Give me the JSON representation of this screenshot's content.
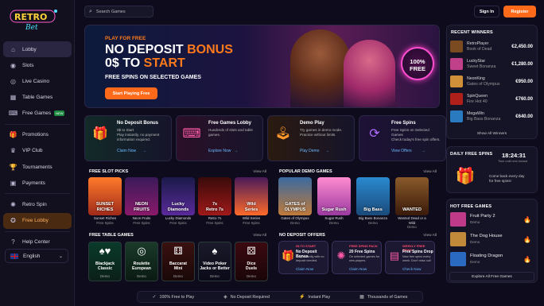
{
  "brand": {
    "logo_top": "RETRO",
    "logo_bottom": "Bet"
  },
  "sidebar": {
    "items": [
      {
        "label": "Lobby",
        "icon": "home-icon"
      },
      {
        "label": "Slots",
        "icon": "slots-icon"
      },
      {
        "label": "Live Casino",
        "icon": "live-icon"
      },
      {
        "label": "Table Games",
        "icon": "cards-icon"
      },
      {
        "label": "Free Games",
        "icon": "gamepad-icon",
        "badge": "NEW"
      },
      {
        "label": "Promotions",
        "icon": "gift-icon"
      },
      {
        "label": "VIP Club",
        "icon": "crown-icon"
      },
      {
        "label": "Tournaments",
        "icon": "trophy-icon"
      },
      {
        "label": "Payments",
        "icon": "wallet-icon"
      },
      {
        "label": "Retro Spin",
        "icon": "spin-icon"
      },
      {
        "label": "Free Lobby",
        "icon": "free-lobby-icon"
      },
      {
        "label": "Help Center",
        "icon": "help-icon"
      }
    ],
    "language": "English"
  },
  "header": {
    "search_placeholder": "Search Games",
    "signin": "Sign In",
    "register": "Register"
  },
  "hero": {
    "kicker": "PLAY FOR FREE",
    "line1a": "NO DEPOSIT ",
    "line1b": "BONUS",
    "line2a": "0$ TO ",
    "line2b": "START",
    "sub": "FREE SPINS ON SELECTED GAMES",
    "cta": "Start Playing Free",
    "seal_1": "100%",
    "seal_2": "FREE"
  },
  "winners": {
    "title": "RECENT WINNERS",
    "rows": [
      {
        "user": "RetroPlayer",
        "game": "Book of Dead",
        "amount": "€2,450.00",
        "color": "#7a4a20"
      },
      {
        "user": "LuckyStar",
        "game": "Sweet Bonanza",
        "amount": "€1,280.00",
        "color": "#c0408a"
      },
      {
        "user": "NeonKing",
        "game": "Gates of Olympus",
        "amount": "€950.00",
        "color": "#d0903a"
      },
      {
        "user": "SpinQueen",
        "game": "Fire Hot 40",
        "amount": "€760.00",
        "color": "#b0201a"
      },
      {
        "user": "MegaWin",
        "game": "Big Bass Bonanza",
        "amount": "€640.00",
        "color": "#2a7ac0"
      }
    ],
    "link": "Show All Winners"
  },
  "promo_cards": [
    {
      "title": "No Deposit Bonus",
      "desc": "0$ to Start\nPlay instantly, no payment information required.",
      "link": "Claim Now",
      "icon": "gift-icon",
      "icon_color": "#3fe0a0",
      "bg": "#122a28"
    },
    {
      "title": "Free Games Lobby",
      "desc": "Hundreds of slots and table games.",
      "link": "Explore Now",
      "icon": "gamepad-icon",
      "icon_color": "#ff5aa8",
      "bg": "#2a1028"
    },
    {
      "title": "Demo Play",
      "desc": "Try games in demo mode. Practice without limits.",
      "link": "Play Demo",
      "icon": "joystick-icon",
      "icon_color": "#ff9a2a",
      "bg": "#2a1a10"
    },
    {
      "title": "Free Spins",
      "desc": "Free Spins on Selected Games\nCheck today's free spin offers.",
      "link": "View Offers",
      "icon": "refresh-icon",
      "icon_color": "#b06aff",
      "bg": "#1e1236"
    }
  ],
  "daily": {
    "title": "DAILY FREE SPINS",
    "timer": "18:24:31",
    "timer_label": "Time until next reward",
    "msg": "Come back every day\nfor free spins!"
  },
  "free_slots": {
    "title": "FREE SLOT PICKS",
    "view_all": "View All",
    "games": [
      {
        "art": "SUNSET\nRICHES",
        "name": "Sunset Riches",
        "tag": "Free Spins",
        "bg": "linear-gradient(#ff7a2a,#a02a1a)"
      },
      {
        "art": "NEON\nFRUITS",
        "name": "Neon Fruits",
        "tag": "Free Spins",
        "bg": "linear-gradient(#3a1a5a,#8a1a6a)"
      },
      {
        "art": "Lucky\nDiamonds",
        "name": "Lucky Diamonds",
        "tag": "Free Spins",
        "bg": "linear-gradient(#1a1a4a,#5a2a9a)"
      },
      {
        "art": "7s\nRetro 7s",
        "name": "Retro 7s",
        "tag": "Free Spins",
        "bg": "linear-gradient(#3a0a0a,#a01a1a)"
      },
      {
        "art": "Wild\nSeries",
        "name": "Wild Series",
        "tag": "Free Spins",
        "bg": "linear-gradient(#4a1a5a,#ff6a2a)"
      }
    ]
  },
  "demo_games": {
    "title": "POPULAR DEMO GAMES",
    "view_all": "View All",
    "games": [
      {
        "art": "GATES of OLYMPUS",
        "name": "Gates of Olympus",
        "tag": "Demo",
        "bg": "linear-gradient(#3a6aa0,#c07a3a)"
      },
      {
        "art": "Sugar Rush",
        "name": "Sugar Rush",
        "tag": "Demo",
        "bg": "linear-gradient(#ff8ad0,#9a3aa0)"
      },
      {
        "art": "Big Bass",
        "name": "Big Bass Bonanza",
        "tag": "Demo",
        "bg": "linear-gradient(#2a8ad0,#1a4a7a)"
      },
      {
        "art": "WANTED",
        "name": "Wanted Dead or a Wild",
        "tag": "Demo",
        "bg": "linear-gradient(#8a5a2a,#3a1a0a)"
      }
    ]
  },
  "table_games": {
    "title": "FREE TABLE GAMES",
    "view_all": "View All",
    "games": [
      {
        "name": "Blackjack\nClassic",
        "tag": "Demo",
        "art": "♠♥",
        "bg": "linear-gradient(#0a3a2a,#0a2018)"
      },
      {
        "name": "Roulette\nEuropean",
        "tag": "Demo",
        "art": "◎",
        "bg": "linear-gradient(#1a3a2a,#0a1a12)"
      },
      {
        "name": "Baccarat\nMini",
        "tag": "Demo",
        "art": "⚅",
        "bg": "linear-gradient(#3a1010,#1a0808)"
      },
      {
        "name": "Video Poker\nJacks or Better",
        "tag": "Demo",
        "art": "♠",
        "bg": "linear-gradient(#1a1a2a,#0a0a18)"
      },
      {
        "name": "Dice\nDuels",
        "tag": "Demo",
        "art": "⚄",
        "bg": "linear-gradient(#3a0a10,#1a0508)"
      }
    ]
  },
  "offers": {
    "title": "NO DEPOSIT OFFERS",
    "view_all": "View All",
    "items": [
      {
        "tag": "0$ TO START",
        "name": "No Deposit Bonus",
        "desc": "Play instantly with no deposit needed.",
        "link": "Claim Now",
        "icon": "gift-icon",
        "icon_color": "#3fe0a0"
      },
      {
        "tag": "FREE SPINS PACK",
        "name": "20 Free Spins",
        "desc": "On selected games for new players.",
        "link": "Claim Now",
        "icon": "spin-icon",
        "icon_color": "#ff5aa8"
      },
      {
        "tag": "WEEKLY FREE SPINS",
        "name": "Free Spins Drop",
        "desc": "New free spins every week. Don't miss out!",
        "link": "Check Now",
        "icon": "calendar-icon",
        "icon_color": "#ff5aa8"
      }
    ]
  },
  "hot": {
    "title": "HOT FREE GAMES",
    "rows": [
      {
        "name": "Fruit Party 2",
        "tag": "Demo",
        "color": "#c03a8a"
      },
      {
        "name": "The Dog House",
        "tag": "Demo",
        "color": "#c08a3a"
      },
      {
        "name": "Floating Dragon",
        "tag": "Demo",
        "color": "#2a6ac0"
      }
    ],
    "link": "Explore All Free Games"
  },
  "footer": [
    {
      "icon": "check-icon",
      "label": "100% Free to Play"
    },
    {
      "icon": "shield-icon",
      "label": "No Deposit Required"
    },
    {
      "icon": "bolt-icon",
      "label": "Instant Play"
    },
    {
      "icon": "games-icon",
      "label": "Thousands of Games"
    }
  ]
}
